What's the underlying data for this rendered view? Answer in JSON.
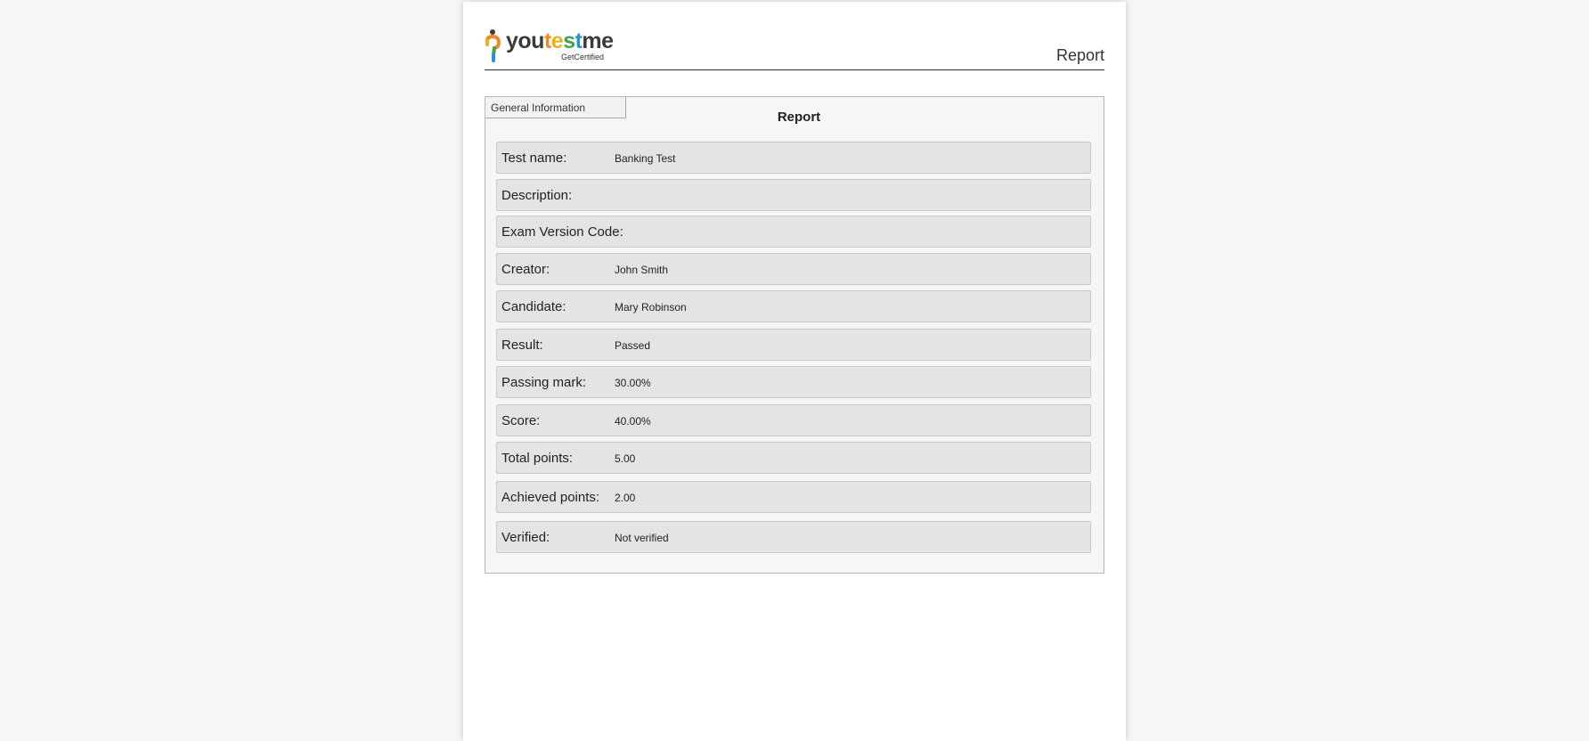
{
  "header": {
    "logo_text": "youtestme",
    "logo_subtext": "GetCertified",
    "title": "Report"
  },
  "panel": {
    "tab_label": "General Information",
    "title": "Report",
    "rows": [
      {
        "label": "Test name:",
        "value": "Banking Test"
      },
      {
        "label": "Description:",
        "value": ""
      },
      {
        "label": "Exam Version Code:",
        "value": ""
      },
      {
        "label": "Creator:",
        "value": "John Smith"
      },
      {
        "label": "Candidate:",
        "value": "Mary Robinson"
      },
      {
        "label": "Result:",
        "value": "Passed"
      },
      {
        "label": "Passing mark:",
        "value": "30.00%"
      },
      {
        "label": "Score:",
        "value": "40.00%"
      },
      {
        "label": "Total points:",
        "value": "5.00"
      },
      {
        "label": "Achieved points:",
        "value": "2.00"
      },
      {
        "label": "Verified:",
        "value": "Not verified"
      }
    ]
  },
  "colors": {
    "background": "#f5f6f8",
    "page": "#ffffff",
    "row": "#e4e4e4",
    "logo_orange": "#f08a24",
    "logo_yellow": "#e9b317",
    "logo_green": "#3fa34d",
    "logo_blue": "#2a8fd6"
  }
}
